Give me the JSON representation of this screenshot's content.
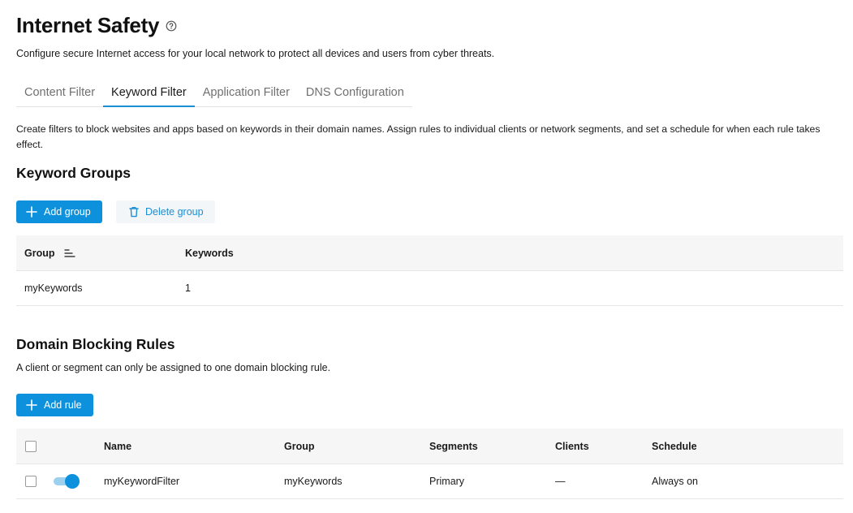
{
  "header": {
    "title": "Internet Safety",
    "subtitle": "Configure secure Internet access for your local network to protect all devices and users from cyber threats."
  },
  "tabs": [
    {
      "label": "Content Filter",
      "active": false
    },
    {
      "label": "Keyword Filter",
      "active": true
    },
    {
      "label": "Application Filter",
      "active": false
    },
    {
      "label": "DNS Configuration",
      "active": false
    }
  ],
  "intro": "Create filters to block websites and apps based on keywords in their domain names. Assign rules to individual clients or network segments, and set a schedule for when each rule takes effect.",
  "keyword_groups": {
    "title": "Keyword Groups",
    "add_label": "Add group",
    "delete_label": "Delete group",
    "columns": {
      "group": "Group",
      "keywords": "Keywords"
    },
    "rows": [
      {
        "group": "myKeywords",
        "keywords": "1"
      }
    ]
  },
  "domain_rules": {
    "title": "Domain Blocking Rules",
    "note": "A client or segment can only be assigned to one domain blocking rule.",
    "add_label": "Add rule",
    "columns": {
      "name": "Name",
      "group": "Group",
      "segments": "Segments",
      "clients": "Clients",
      "schedule": "Schedule"
    },
    "rows": [
      {
        "enabled": true,
        "name": "myKeywordFilter",
        "group": "myKeywords",
        "segments": "Primary",
        "clients": "—",
        "schedule": "Always on"
      }
    ]
  },
  "colors": {
    "accent": "#0d91dc",
    "toggle_track": "#9dd0ef",
    "header_bg": "#f6f6f6"
  },
  "icons": {
    "help": "help-circle-icon",
    "plus": "plus-icon",
    "trash": "trash-icon",
    "sort": "sort-icon"
  }
}
